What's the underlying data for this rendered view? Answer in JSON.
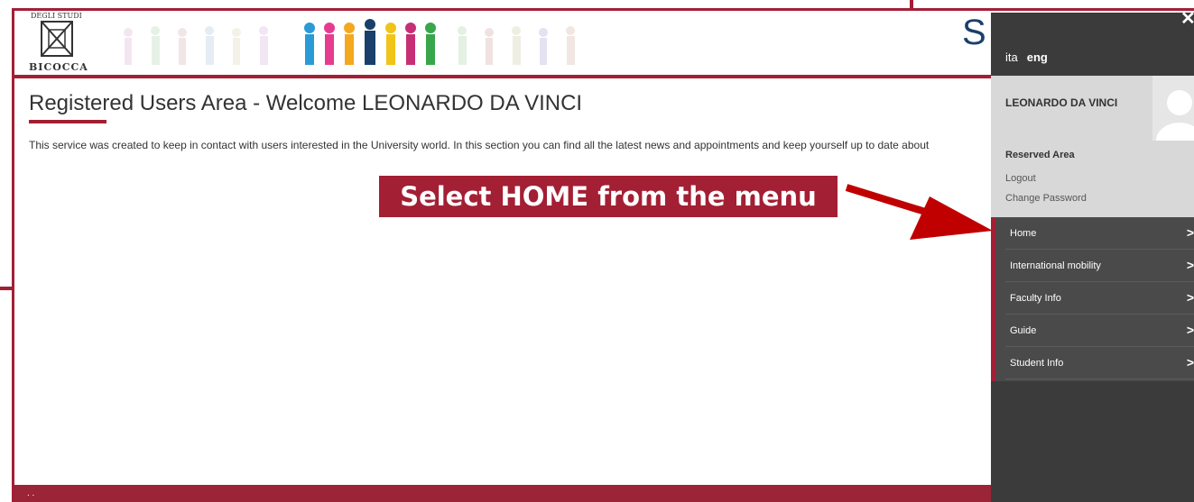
{
  "header": {
    "logo_top": "DEGLI STUDI",
    "logo_bottom": "BICOCCA",
    "brand_letter": "S"
  },
  "page": {
    "title": "Registered Users Area - Welcome LEONARDO DA VINCI",
    "intro": "This service was created to keep in contact with users interested in the University world. In this section you can find all the latest news and appointments and keep yourself up to date about"
  },
  "annotation": {
    "callout": "Select HOME from the menu"
  },
  "panel": {
    "close_glyph": "✕",
    "lang": {
      "ita": "ita",
      "eng": "eng"
    },
    "user_name": "LEONARDO DA VINCI",
    "reserved_area": "Reserved Area",
    "logout": "Logout",
    "change_password": "Change Password",
    "menu": [
      {
        "label": "Home",
        "chevron": ">"
      },
      {
        "label": "International mobility",
        "chevron": ">"
      },
      {
        "label": "Faculty Info",
        "chevron": ">"
      },
      {
        "label": "Guide",
        "chevron": ">"
      },
      {
        "label": "Student Info",
        "chevron": ">"
      }
    ]
  },
  "footer": {
    "text": ". ."
  },
  "colors": {
    "accent": "#a31f34",
    "panel": "#3b3b3b",
    "menu": "#4a4a4a",
    "userbox": "#d8d8d8"
  }
}
